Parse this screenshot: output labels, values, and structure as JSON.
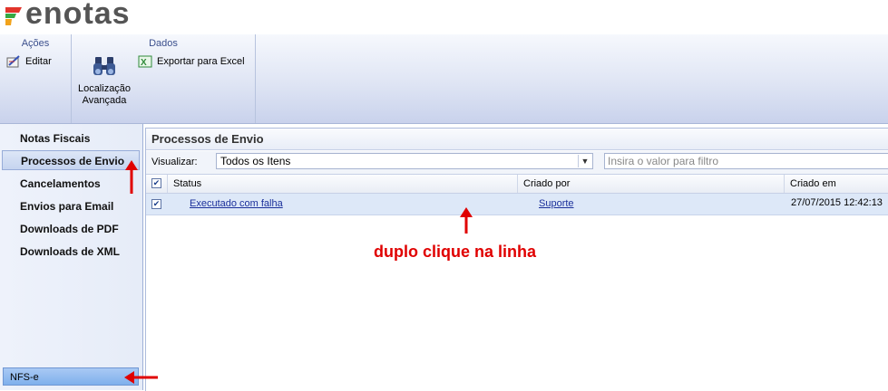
{
  "app": {
    "brand": "enotas"
  },
  "ribbon": {
    "acoes": {
      "title": "Ações",
      "editar_label": "Editar"
    },
    "dados": {
      "title": "Dados",
      "localizacao_line1": "Localização",
      "localizacao_line2": "Avançada",
      "exportar_label": "Exportar para Excel"
    }
  },
  "sidebar": {
    "items": [
      {
        "label": "Notas Fiscais",
        "active": false
      },
      {
        "label": "Processos de Envio",
        "active": true
      },
      {
        "label": "Cancelamentos",
        "active": false
      },
      {
        "label": "Envios para Email",
        "active": false
      },
      {
        "label": "Downloads de PDF",
        "active": false
      },
      {
        "label": "Downloads de XML",
        "active": false
      }
    ],
    "bottom_item": "NFS-e"
  },
  "main": {
    "title": "Processos de Envio",
    "visualizar_label": "Visualizar:",
    "visualizar_value": "Todos os Itens",
    "filter_placeholder": "Insira o valor para filtro",
    "filter_value": "",
    "columns": [
      "Status",
      "Criado por",
      "Criado em"
    ],
    "rows": [
      {
        "checked": true,
        "status": "Executado com falha",
        "criado_por": "Suporte",
        "criado_em": "27/07/2015 12:42:13"
      }
    ]
  },
  "annotation": {
    "text": "duplo clique na linha",
    "color": "#e00000"
  },
  "colors": {
    "ribbon_title": "#3a4e8c",
    "link": "#1a2f9a",
    "row_selected": "#dde8f8",
    "annotation": "#e00000"
  }
}
